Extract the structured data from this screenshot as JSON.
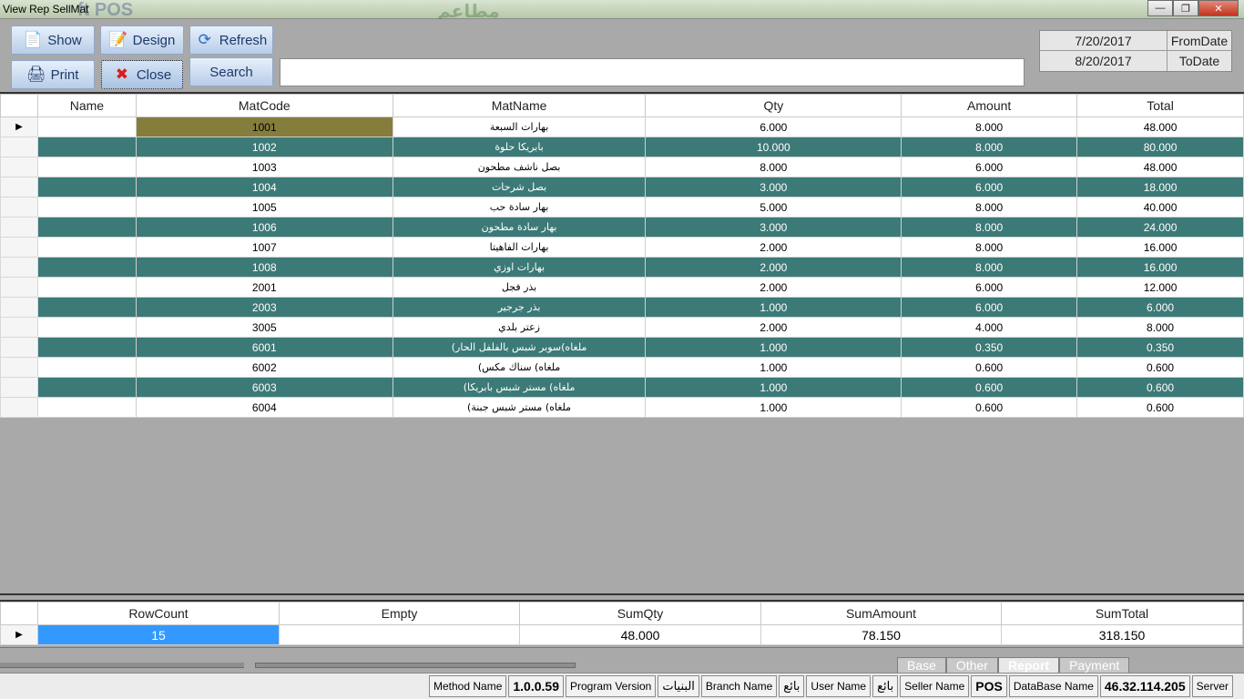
{
  "window": {
    "title": "View Rep SellMat",
    "ghost_left": "ft POS",
    "ghost_center": "مطاعم"
  },
  "toolbar": {
    "show": "Show",
    "design": "Design",
    "refresh": "Refresh",
    "print": "Print",
    "close": "Close",
    "search": "Search",
    "search_value": ""
  },
  "dates": {
    "from_value": "7/20/2017",
    "from_label": "FromDate",
    "to_value": "8/20/2017",
    "to_label": "ToDate"
  },
  "grid": {
    "columns": [
      "Name",
      "MatCode",
      "MatName",
      "Qty",
      "Amount",
      "Total"
    ],
    "rows": [
      {
        "name": "",
        "code": "1001",
        "mat": "بهارات السبعة",
        "qty": "6.000",
        "amount": "8.000",
        "total": "48.000"
      },
      {
        "name": "",
        "code": "1002",
        "mat": "بابريكا حلوة",
        "qty": "10.000",
        "amount": "8.000",
        "total": "80.000"
      },
      {
        "name": "",
        "code": "1003",
        "mat": "بصل ناشف مطحون",
        "qty": "8.000",
        "amount": "6.000",
        "total": "48.000"
      },
      {
        "name": "",
        "code": "1004",
        "mat": "بصل شرحات",
        "qty": "3.000",
        "amount": "6.000",
        "total": "18.000"
      },
      {
        "name": "",
        "code": "1005",
        "mat": "بهار سادة حب",
        "qty": "5.000",
        "amount": "8.000",
        "total": "40.000"
      },
      {
        "name": "",
        "code": "1006",
        "mat": "بهار سادة مطحون",
        "qty": "3.000",
        "amount": "8.000",
        "total": "24.000"
      },
      {
        "name": "",
        "code": "1007",
        "mat": "بهارات الفاهيتا",
        "qty": "2.000",
        "amount": "8.000",
        "total": "16.000"
      },
      {
        "name": "",
        "code": "1008",
        "mat": "بهارات اوزي",
        "qty": "2.000",
        "amount": "8.000",
        "total": "16.000"
      },
      {
        "name": "",
        "code": "2001",
        "mat": "بذر فجل",
        "qty": "2.000",
        "amount": "6.000",
        "total": "12.000"
      },
      {
        "name": "",
        "code": "2003",
        "mat": "بذر جرجير",
        "qty": "1.000",
        "amount": "6.000",
        "total": "6.000"
      },
      {
        "name": "",
        "code": "3005",
        "mat": "زعتر بلدي",
        "qty": "2.000",
        "amount": "4.000",
        "total": "8.000"
      },
      {
        "name": "",
        "code": "6001",
        "mat": "ملغاه)سوبر شبس بالفلفل الحار)",
        "qty": "1.000",
        "amount": "0.350",
        "total": "0.350"
      },
      {
        "name": "",
        "code": "6002",
        "mat": "ملغاه) سناك مكس)",
        "qty": "1.000",
        "amount": "0.600",
        "total": "0.600"
      },
      {
        "name": "",
        "code": "6003",
        "mat": "ملغاه) مستر شبس بابريكا)",
        "qty": "1.000",
        "amount": "0.600",
        "total": "0.600"
      },
      {
        "name": "",
        "code": "6004",
        "mat": "ملغاه) مستر شبس جبنة)",
        "qty": "1.000",
        "amount": "0.600",
        "total": "0.600"
      }
    ]
  },
  "summary": {
    "columns": [
      "RowCount",
      "Empty",
      "SumQty",
      "SumAmount",
      "SumTotal"
    ],
    "values": [
      "15",
      "",
      "48.000",
      "78.150",
      "318.150"
    ]
  },
  "tabs": [
    "Base",
    "Other",
    "Report",
    "Payment"
  ],
  "statusbar": [
    {
      "label": "Method Name",
      "kind": "label"
    },
    {
      "label": "1.0.0.59",
      "kind": "val"
    },
    {
      "label": "Program Version",
      "kind": "label"
    },
    {
      "label": "البنيات",
      "kind": "ar"
    },
    {
      "label": "Branch Name",
      "kind": "label"
    },
    {
      "label": "بائع",
      "kind": "ar"
    },
    {
      "label": "User Name",
      "kind": "label"
    },
    {
      "label": "بائع",
      "kind": "ar"
    },
    {
      "label": "Seller Name",
      "kind": "label"
    },
    {
      "label": "POS",
      "kind": "val"
    },
    {
      "label": "DataBase Name",
      "kind": "label"
    },
    {
      "label": "46.32.114.205",
      "kind": "val"
    },
    {
      "label": "Server",
      "kind": "label"
    }
  ]
}
